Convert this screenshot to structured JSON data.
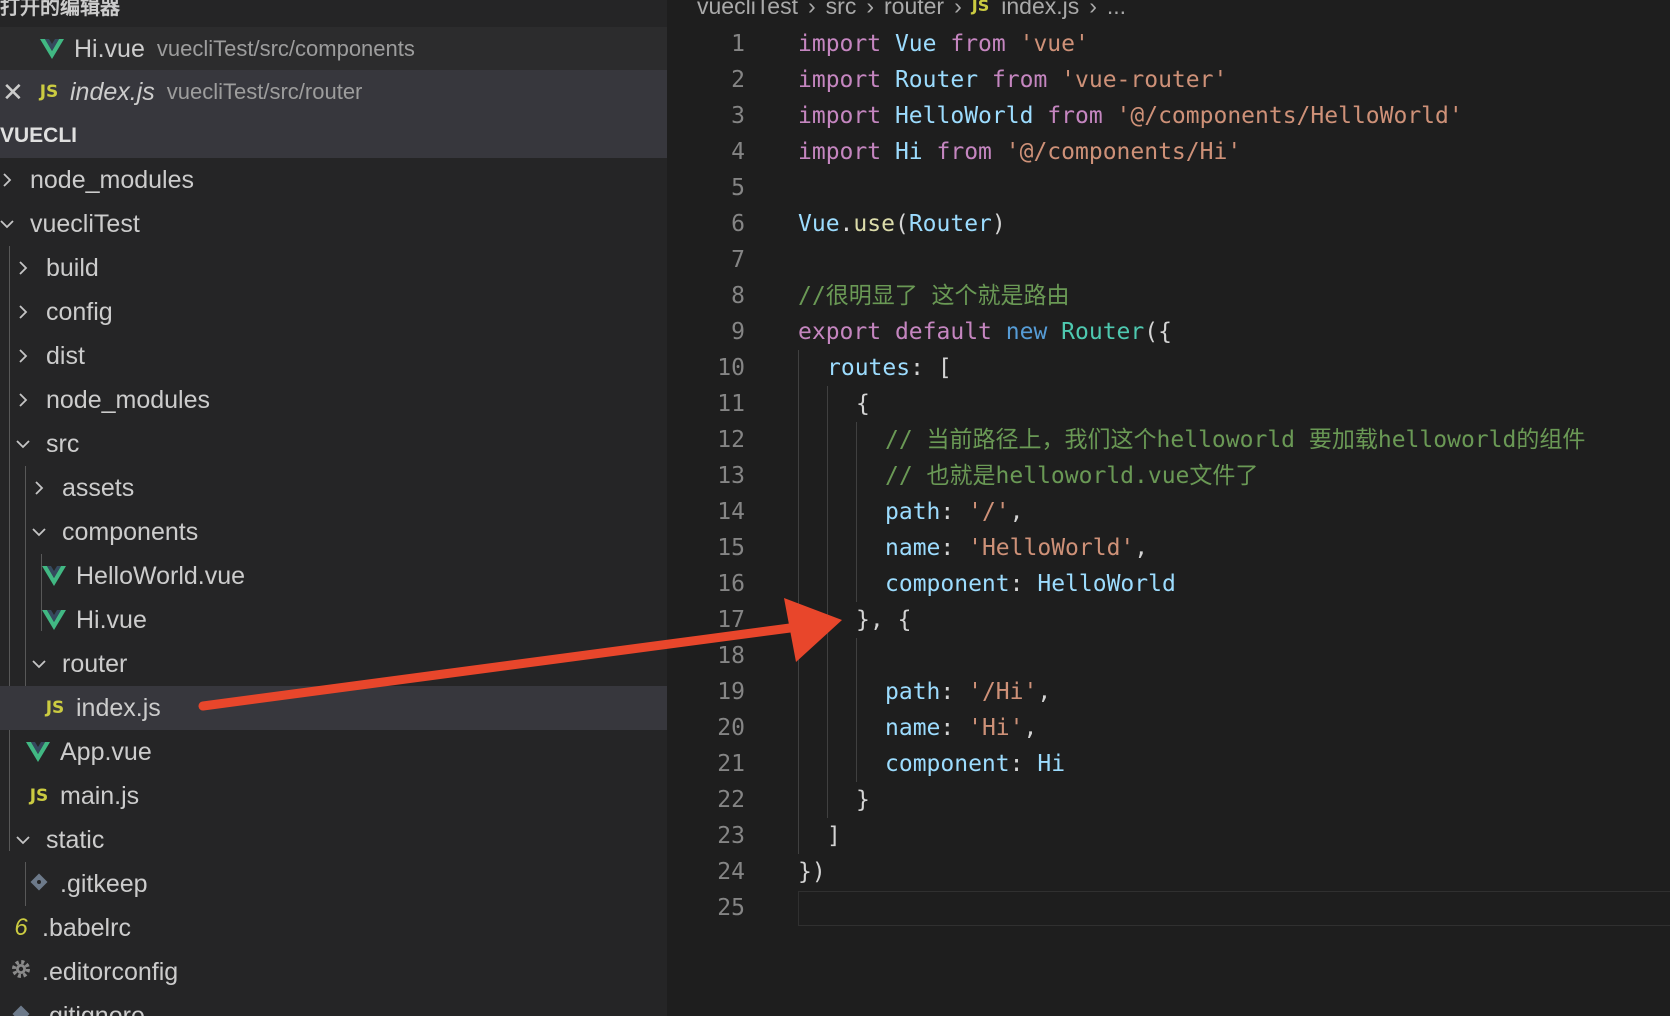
{
  "open_editors": {
    "header": "打开的编辑器",
    "items": [
      {
        "name": "Hi.vue",
        "path": "vuecliTest/src/components",
        "type": "vue"
      },
      {
        "name": "index.js",
        "path": "vuecliTest/src/router",
        "type": "js"
      }
    ]
  },
  "explorer": {
    "header": "VUECLI",
    "items": [
      {
        "label": "node_modules"
      },
      {
        "label": "vuecliTest"
      },
      {
        "label": "build"
      },
      {
        "label": "config"
      },
      {
        "label": "dist"
      },
      {
        "label": "node_modules"
      },
      {
        "label": "src"
      },
      {
        "label": "assets"
      },
      {
        "label": "components"
      },
      {
        "label": "HelloWorld.vue"
      },
      {
        "label": "Hi.vue"
      },
      {
        "label": "router"
      },
      {
        "label": "index.js"
      },
      {
        "label": "App.vue"
      },
      {
        "label": "main.js"
      },
      {
        "label": "static"
      },
      {
        "label": ".gitkeep"
      },
      {
        "label": ".babelrc"
      },
      {
        "label": ".editorconfig"
      },
      {
        "label": ".gitignore"
      }
    ]
  },
  "breadcrumb": {
    "parts": [
      "vuecliTest",
      "src",
      "router",
      "index.js",
      "..."
    ],
    "js_badge": "JS"
  },
  "icons": {
    "js": "JS",
    "babel": "6",
    "close": "✕"
  },
  "editor": {
    "line_numbers": [
      "1",
      "2",
      "3",
      "4",
      "5",
      "6",
      "7",
      "8",
      "9",
      "10",
      "11",
      "12",
      "13",
      "14",
      "15",
      "16",
      "17",
      "18",
      "19",
      "20",
      "21",
      "22",
      "23",
      "24",
      "25"
    ],
    "lines": [
      "import Vue from 'vue'",
      "import Router from 'vue-router'",
      "import HelloWorld from '@/components/HelloWorld'",
      "import Hi from '@/components/Hi'",
      "",
      "Vue.use(Router)",
      "",
      "//很明显了 这个就是路由",
      "export default new Router({",
      "routes: [",
      "{",
      "// 当前路径上，我们这个helloworld 要加载helloworld的组件",
      "// 也就是helloworld.vue文件了",
      "path: '/',",
      "name: 'HelloWorld',",
      "component: HelloWorld",
      "}, {",
      "",
      "path: '/Hi',",
      "name: 'Hi',",
      "component: Hi",
      "}",
      "]",
      "})",
      ""
    ]
  },
  "colors": {
    "sidebar_bg": "#252526",
    "editor_bg": "#1e1e1e",
    "keyword": "#c586c0",
    "string": "#ce9178",
    "comment": "#6a9955",
    "variable": "#9cdcfe",
    "arrow": "#e8462b",
    "vue_green": "#41b883",
    "js_yellow": "#cbcb41"
  }
}
